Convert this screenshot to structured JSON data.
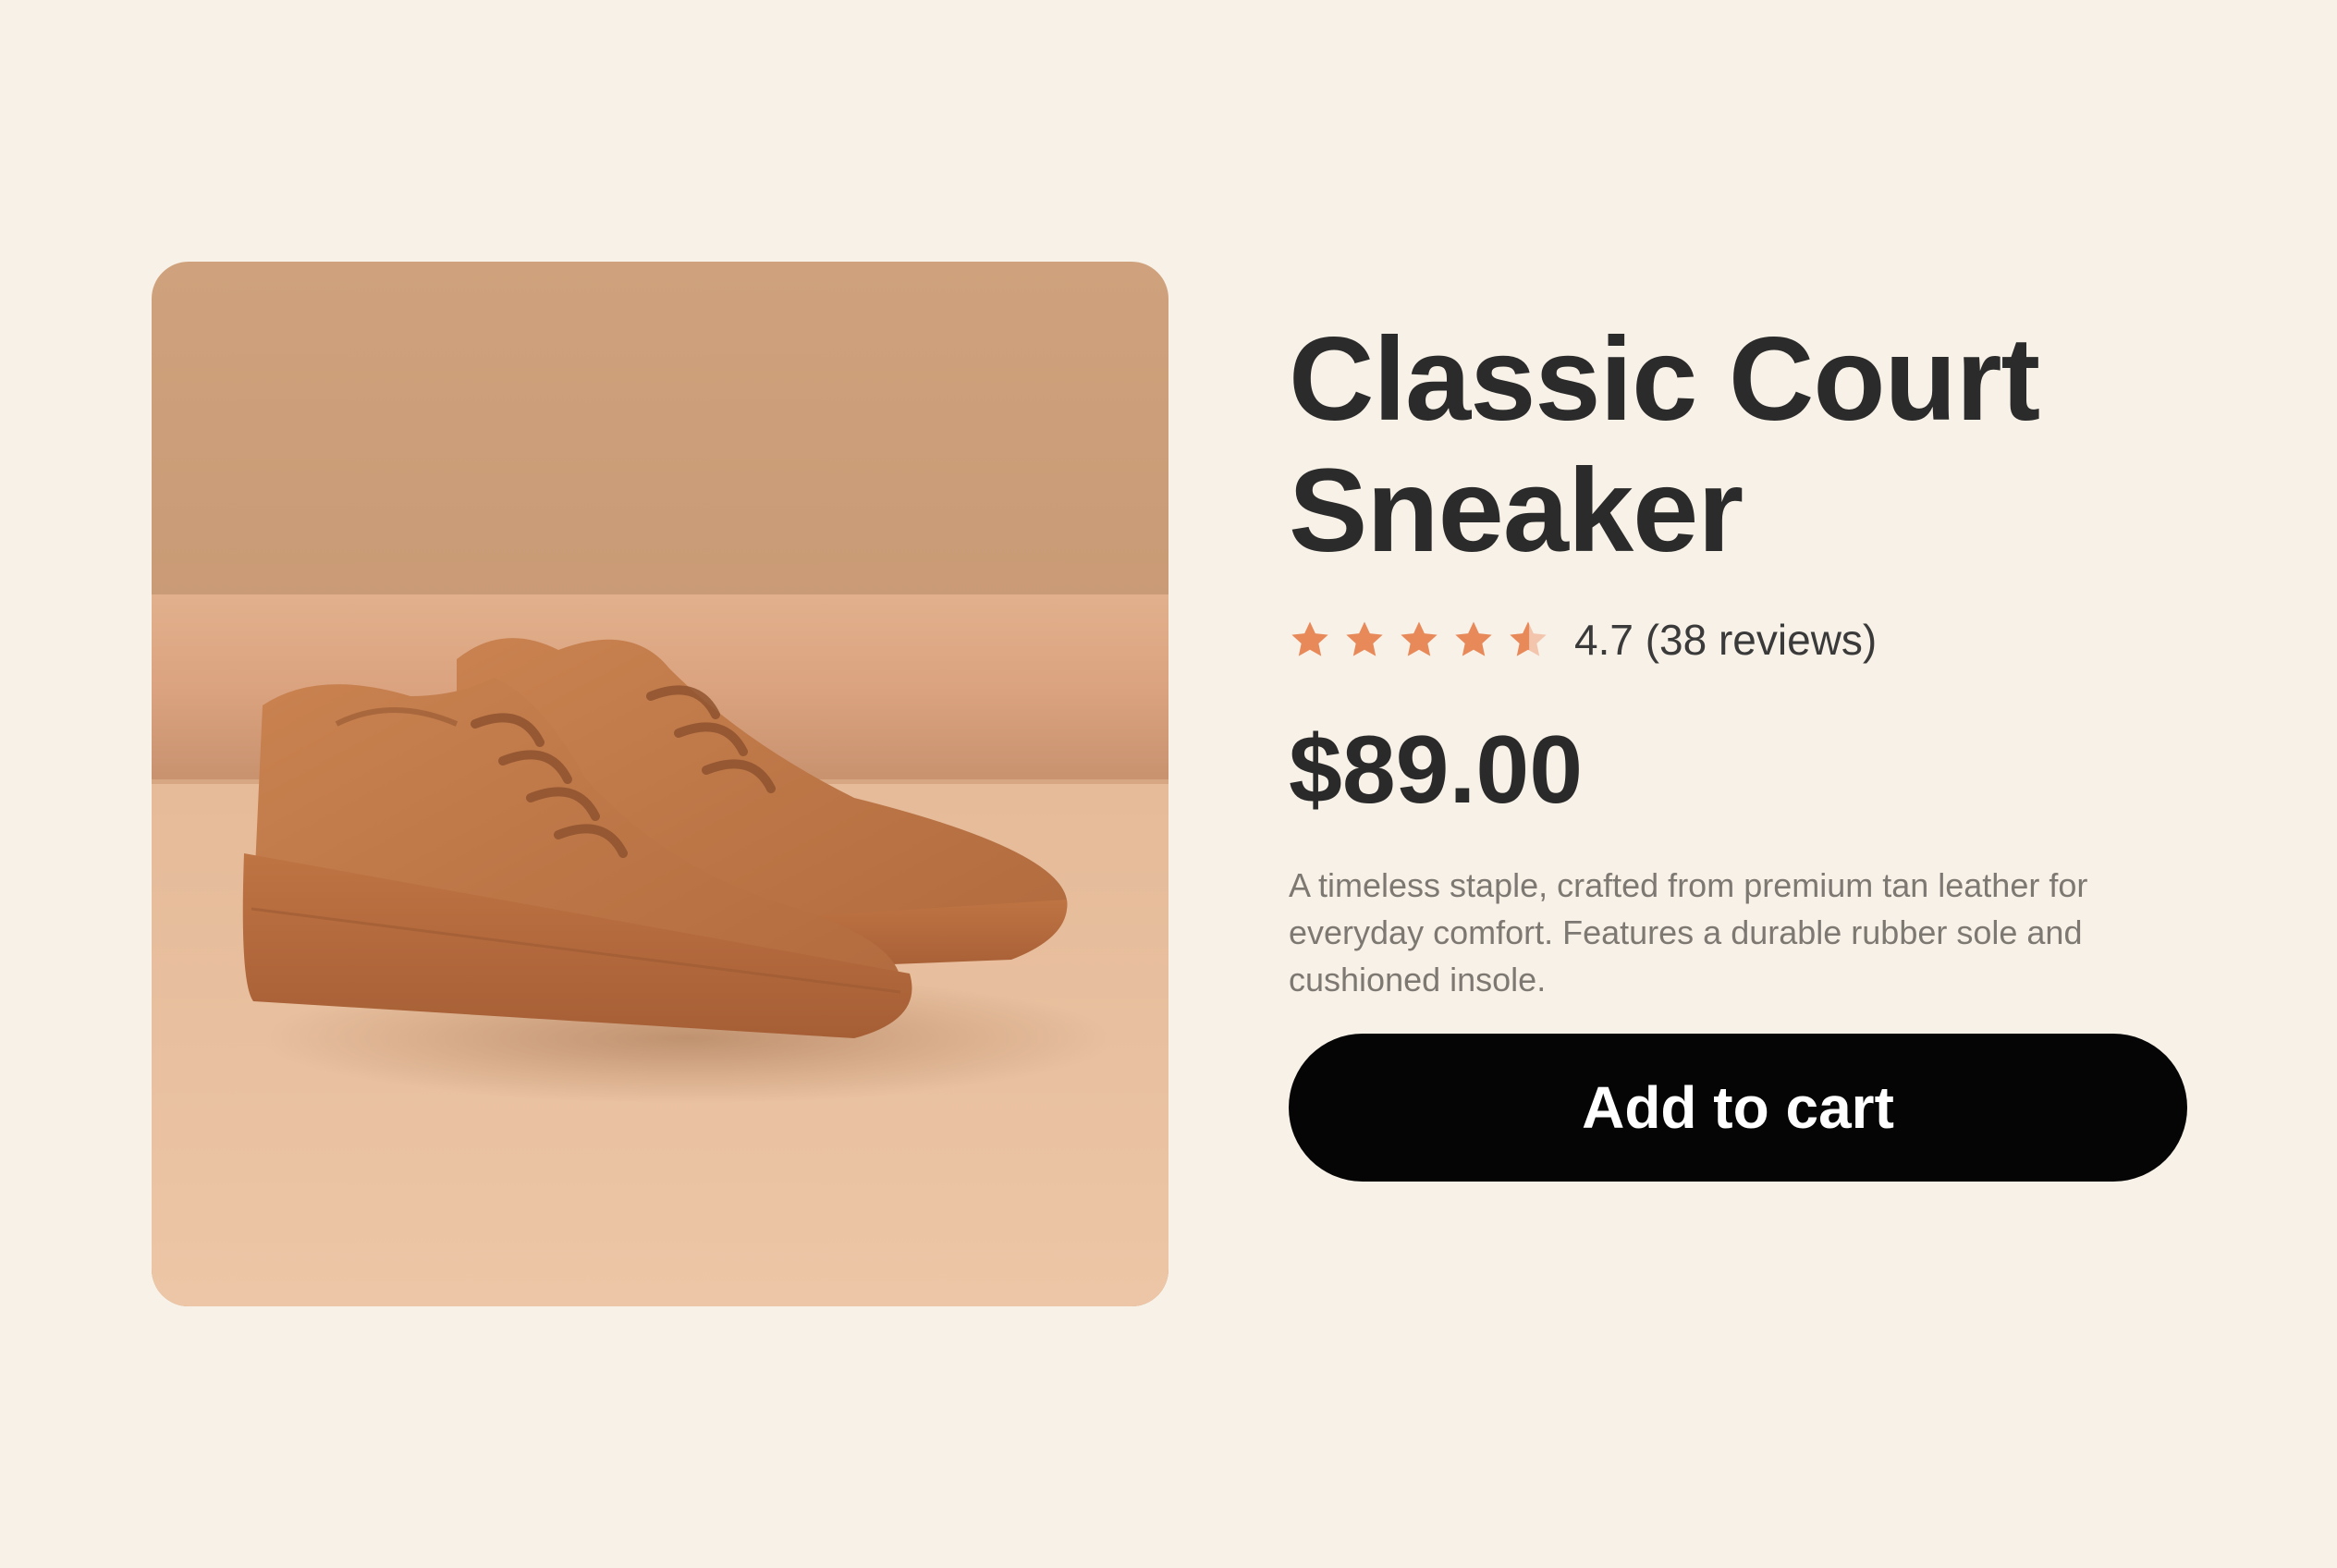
{
  "product": {
    "title": "Classic Court Sneaker",
    "rating": {
      "value": 4.7,
      "max": 5,
      "text": "4.7 (38 reviews)"
    },
    "price": "$89.00",
    "description": "A timeless staple, crafted from premium tan leather for everyday comfort. Features a durable rubber sole and cushioned insole.",
    "cart_button_label": "Add to cart",
    "image_icon": "tan-leather-sneakers-photo"
  },
  "colors": {
    "background": "#f7f1e7",
    "star": "#e8895a",
    "star_empty": "#f3c5ad",
    "button": "#050505",
    "title": "#2b2b2b",
    "description": "#7e7873"
  }
}
